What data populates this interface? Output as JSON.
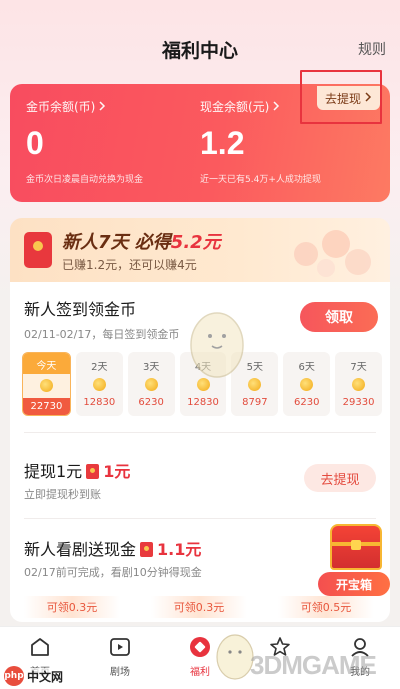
{
  "header": {
    "title": "福利中心",
    "rules_link": "规则"
  },
  "balances": {
    "coin_label": "金币余额(币)",
    "coin_value": "0",
    "coin_note": "金币次日凌晨自动兑换为现金",
    "cash_label": "现金余额(元)",
    "cash_value": "1.2",
    "cash_note": "近一天已有5.4万+人成功提现",
    "withdraw_chip": "去提现"
  },
  "banner": {
    "title_part1": "新人7天 必得",
    "title_amount": "5.2元",
    "subtitle": "已赚1.2元，还可以赚4元"
  },
  "checkin": {
    "title": "新人签到领金币",
    "subtitle": "02/11-02/17，每日签到领金币",
    "button": "领取",
    "days": [
      {
        "label": "今天",
        "amount": "22730",
        "today": true
      },
      {
        "label": "2天",
        "amount": "12830"
      },
      {
        "label": "3天",
        "amount": "6230"
      },
      {
        "label": "4天",
        "amount": "12830"
      },
      {
        "label": "5天",
        "amount": "8797"
      },
      {
        "label": "6天",
        "amount": "6230"
      },
      {
        "label": "7天",
        "amount": "29330"
      }
    ]
  },
  "withdraw_task": {
    "title": "提现1元",
    "amount": "1元",
    "subtitle": "立即提现秒到账",
    "button": "去提现"
  },
  "drama_task": {
    "title": "新人看剧送现金",
    "amount": "1.1元",
    "subtitle": "02/17前可完成，看剧10分钟得现金",
    "chips": [
      "可领0.3元",
      "可领0.3元",
      "可领0.5元"
    ]
  },
  "treasure": {
    "label": "开宝箱"
  },
  "nav": [
    {
      "label": "首页",
      "icon": "home-icon"
    },
    {
      "label": "剧场",
      "icon": "play-icon"
    },
    {
      "label": "福利",
      "icon": "gift-icon",
      "active": true
    },
    {
      "label": "",
      "icon": "star-icon"
    },
    {
      "label": "我的",
      "icon": "profile-icon"
    }
  ],
  "watermarks": {
    "left": "中文网",
    "left_logo": "php",
    "right": "3DMGAME"
  },
  "colors": {
    "accent": "#e8333e",
    "card_start": "#f84c5f",
    "card_end": "#fd7a62"
  }
}
